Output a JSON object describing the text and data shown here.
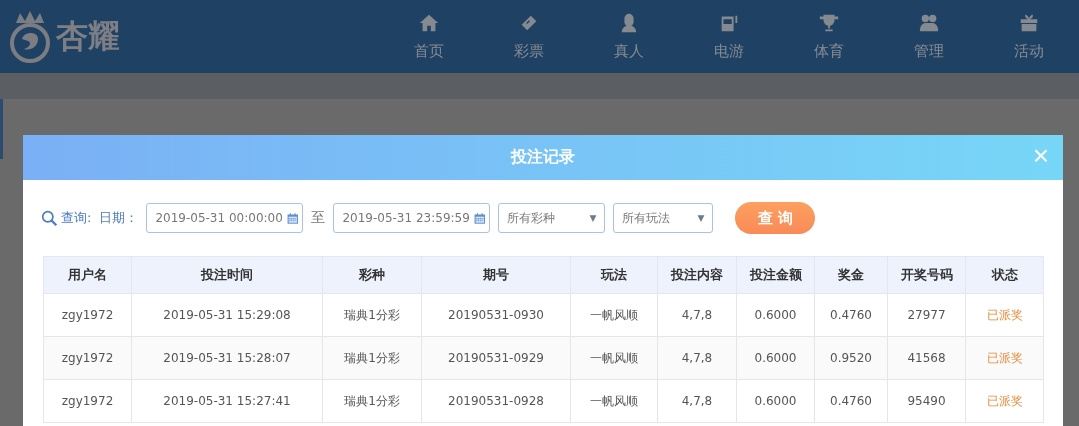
{
  "header": {
    "logo_text": "杏耀",
    "nav": [
      {
        "label": "首页"
      },
      {
        "label": "彩票"
      },
      {
        "label": "真人"
      },
      {
        "label": "电游"
      },
      {
        "label": "体育"
      },
      {
        "label": "管理"
      },
      {
        "label": "活动"
      }
    ]
  },
  "dialog": {
    "title": "投注记录",
    "close": "×",
    "filter": {
      "query_label": "查询:",
      "date_label": "日期：",
      "start": "2019-05-31 00:00:00",
      "separator": "至",
      "end": "2019-05-31 23:59:59",
      "lottery_select": "所有彩种",
      "play_select": "所有玩法",
      "caret": "▼",
      "button": "查 询"
    },
    "table": {
      "columns": [
        "用户名",
        "投注时间",
        "彩种",
        "期号",
        "玩法",
        "投注内容",
        "投注金额",
        "奖金",
        "开奖号码",
        "状态"
      ],
      "rows": [
        [
          "zgy1972",
          "2019-05-31 15:29:08",
          "瑞典1分彩",
          "20190531-0930",
          "一帆风顺",
          "4,7,8",
          "0.6000",
          "0.4760",
          "27977",
          "已派奖"
        ],
        [
          "zgy1972",
          "2019-05-31 15:28:07",
          "瑞典1分彩",
          "20190531-0929",
          "一帆风顺",
          "4,7,8",
          "0.6000",
          "0.9520",
          "41568",
          "已派奖"
        ],
        [
          "zgy1972",
          "2019-05-31 15:27:41",
          "瑞典1分彩",
          "20190531-0928",
          "一帆风顺",
          "4,7,8",
          "0.6000",
          "0.4760",
          "95490",
          "已派奖"
        ]
      ]
    }
  }
}
